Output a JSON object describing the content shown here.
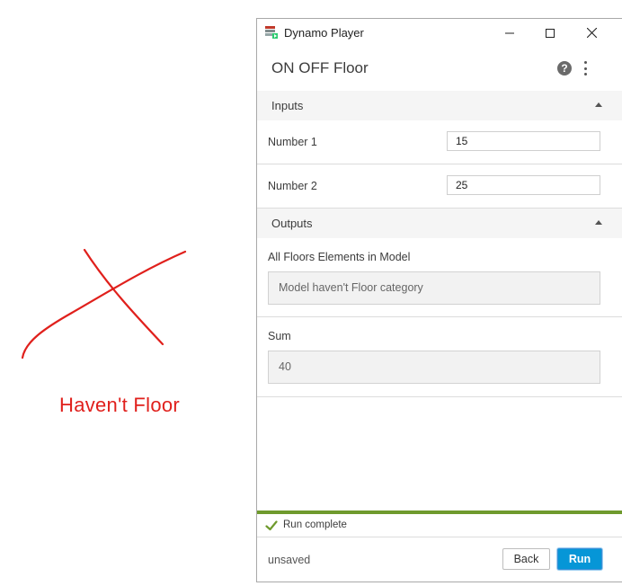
{
  "annotation": {
    "text": "Haven't Floor",
    "color": "#e0201c"
  },
  "window": {
    "title": "Dynamo Player",
    "controls": {
      "minimize": "—",
      "maximize": "☐",
      "close": "✕"
    }
  },
  "header": {
    "title": "ON OFF Floor",
    "help_icon": "?",
    "more_icon": "more-vertical-icon"
  },
  "inputs": {
    "label": "Inputs",
    "items": [
      {
        "label": "Number 1",
        "value": "15"
      },
      {
        "label": "Number 2",
        "value": "25"
      }
    ]
  },
  "outputs": {
    "label": "Outputs",
    "items": [
      {
        "label": "All Floors Elements in Model",
        "value": "Model haven't Floor category"
      },
      {
        "label": "Sum",
        "value": "40"
      }
    ]
  },
  "status": {
    "text": "Run complete",
    "color": "#6f9a2d"
  },
  "footer": {
    "file_state": "unsaved",
    "back_label": "Back",
    "run_label": "Run",
    "run_color": "#0696d7"
  }
}
